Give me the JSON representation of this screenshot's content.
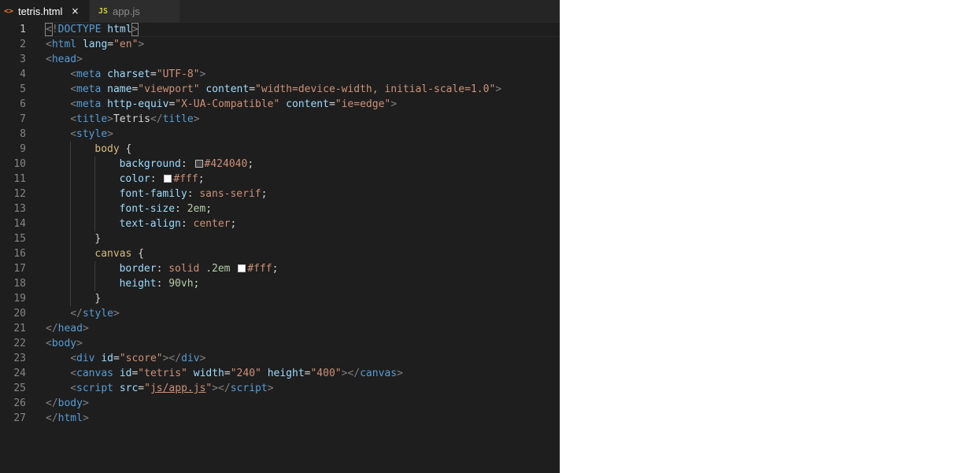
{
  "tabs": [
    {
      "label": "tetris.html",
      "icon": "<>",
      "icon_name": "html-file-icon",
      "active": true,
      "close": "×"
    },
    {
      "label": "app.js",
      "icon": "JS",
      "icon_name": "javascript-file-icon",
      "active": false
    }
  ],
  "colors": {
    "editor_bg": "#1e1e1e",
    "tabbar_bg": "#252526",
    "tag": "#569cd6",
    "attr": "#9cdcfe",
    "string": "#ce9178",
    "punctuation": "#808080",
    "selector": "#d7ba7d",
    "number": "#b5cea8"
  },
  "editor": {
    "current_line": 1,
    "lines": [
      {
        "n": "1",
        "indent": 0,
        "tokens": [
          [
            "punc",
            "<"
          ],
          [
            "punc",
            "!"
          ],
          [
            "tag",
            "DOCTYPE"
          ],
          [
            "text",
            " "
          ],
          [
            "attr",
            "html"
          ],
          [
            "punc",
            ">"
          ]
        ]
      },
      {
        "n": "2",
        "indent": 0,
        "tokens": [
          [
            "punc",
            "<"
          ],
          [
            "tag",
            "html"
          ],
          [
            "text",
            " "
          ],
          [
            "attr",
            "lang"
          ],
          [
            "text",
            "="
          ],
          [
            "str",
            "\"en\""
          ],
          [
            "punc",
            ">"
          ]
        ]
      },
      {
        "n": "3",
        "indent": 0,
        "tokens": [
          [
            "punc",
            "<"
          ],
          [
            "tag",
            "head"
          ],
          [
            "punc",
            ">"
          ]
        ]
      },
      {
        "n": "4",
        "indent": 1,
        "tokens": [
          [
            "punc",
            "<"
          ],
          [
            "tag",
            "meta"
          ],
          [
            "text",
            " "
          ],
          [
            "attr",
            "charset"
          ],
          [
            "text",
            "="
          ],
          [
            "str",
            "\"UTF-8\""
          ],
          [
            "punc",
            ">"
          ]
        ]
      },
      {
        "n": "5",
        "indent": 1,
        "tokens": [
          [
            "punc",
            "<"
          ],
          [
            "tag",
            "meta"
          ],
          [
            "text",
            " "
          ],
          [
            "attr",
            "name"
          ],
          [
            "text",
            "="
          ],
          [
            "str",
            "\"viewport\""
          ],
          [
            "text",
            " "
          ],
          [
            "attr",
            "content"
          ],
          [
            "text",
            "="
          ],
          [
            "str",
            "\"width=device-width, initial-scale=1.0\""
          ],
          [
            "punc",
            ">"
          ]
        ]
      },
      {
        "n": "6",
        "indent": 1,
        "tokens": [
          [
            "punc",
            "<"
          ],
          [
            "tag",
            "meta"
          ],
          [
            "text",
            " "
          ],
          [
            "attr",
            "http-equiv"
          ],
          [
            "text",
            "="
          ],
          [
            "str",
            "\"X-UA-Compatible\""
          ],
          [
            "text",
            " "
          ],
          [
            "attr",
            "content"
          ],
          [
            "text",
            "="
          ],
          [
            "str",
            "\"ie=edge\""
          ],
          [
            "punc",
            ">"
          ]
        ]
      },
      {
        "n": "7",
        "indent": 1,
        "tokens": [
          [
            "punc",
            "<"
          ],
          [
            "tag",
            "title"
          ],
          [
            "punc",
            ">"
          ],
          [
            "text",
            "Tetris"
          ],
          [
            "punc",
            "</"
          ],
          [
            "tag",
            "title"
          ],
          [
            "punc",
            ">"
          ]
        ]
      },
      {
        "n": "8",
        "indent": 1,
        "tokens": [
          [
            "punc",
            "<"
          ],
          [
            "tag",
            "style"
          ],
          [
            "punc",
            ">"
          ]
        ]
      },
      {
        "n": "9",
        "indent": 2,
        "tokens": [
          [
            "sel",
            "body"
          ],
          [
            "text",
            " {"
          ]
        ]
      },
      {
        "n": "10",
        "indent": 3,
        "tokens": [
          [
            "prop",
            "background"
          ],
          [
            "text",
            ": "
          ],
          [
            "swatch",
            "#424040"
          ],
          [
            "val",
            "#424040"
          ],
          [
            "text",
            ";"
          ]
        ]
      },
      {
        "n": "11",
        "indent": 3,
        "tokens": [
          [
            "prop",
            "color"
          ],
          [
            "text",
            ": "
          ],
          [
            "swatch",
            "#fff"
          ],
          [
            "val",
            "#fff"
          ],
          [
            "text",
            ";"
          ]
        ]
      },
      {
        "n": "12",
        "indent": 3,
        "tokens": [
          [
            "prop",
            "font-family"
          ],
          [
            "text",
            ": "
          ],
          [
            "val",
            "sans-serif"
          ],
          [
            "text",
            ";"
          ]
        ]
      },
      {
        "n": "13",
        "indent": 3,
        "tokens": [
          [
            "prop",
            "font-size"
          ],
          [
            "text",
            ": "
          ],
          [
            "num",
            "2em"
          ],
          [
            "text",
            ";"
          ]
        ]
      },
      {
        "n": "14",
        "indent": 3,
        "tokens": [
          [
            "prop",
            "text-align"
          ],
          [
            "text",
            ": "
          ],
          [
            "val",
            "center"
          ],
          [
            "text",
            ";"
          ]
        ]
      },
      {
        "n": "15",
        "indent": 2,
        "tokens": [
          [
            "text",
            "}"
          ]
        ]
      },
      {
        "n": "16",
        "indent": 2,
        "tokens": [
          [
            "sel",
            "canvas"
          ],
          [
            "text",
            " {"
          ]
        ]
      },
      {
        "n": "17",
        "indent": 3,
        "tokens": [
          [
            "prop",
            "border"
          ],
          [
            "text",
            ": "
          ],
          [
            "val",
            "solid"
          ],
          [
            "text",
            " "
          ],
          [
            "num",
            ".2em"
          ],
          [
            "text",
            " "
          ],
          [
            "swatch",
            "#fff"
          ],
          [
            "val",
            "#fff"
          ],
          [
            "text",
            ";"
          ]
        ]
      },
      {
        "n": "18",
        "indent": 3,
        "tokens": [
          [
            "prop",
            "height"
          ],
          [
            "text",
            ": "
          ],
          [
            "num",
            "90vh"
          ],
          [
            "text",
            ";"
          ]
        ]
      },
      {
        "n": "19",
        "indent": 2,
        "tokens": [
          [
            "text",
            "}"
          ]
        ]
      },
      {
        "n": "20",
        "indent": 1,
        "tokens": [
          [
            "punc",
            "</"
          ],
          [
            "tag",
            "style"
          ],
          [
            "punc",
            ">"
          ]
        ]
      },
      {
        "n": "21",
        "indent": 0,
        "tokens": [
          [
            "punc",
            "</"
          ],
          [
            "tag",
            "head"
          ],
          [
            "punc",
            ">"
          ]
        ]
      },
      {
        "n": "22",
        "indent": 0,
        "tokens": [
          [
            "punc",
            "<"
          ],
          [
            "tag",
            "body"
          ],
          [
            "punc",
            ">"
          ]
        ]
      },
      {
        "n": "23",
        "indent": 1,
        "tokens": [
          [
            "punc",
            "<"
          ],
          [
            "tag",
            "div"
          ],
          [
            "text",
            " "
          ],
          [
            "attr",
            "id"
          ],
          [
            "text",
            "="
          ],
          [
            "str",
            "\"score\""
          ],
          [
            "punc",
            "></"
          ],
          [
            "tag",
            "div"
          ],
          [
            "punc",
            ">"
          ]
        ]
      },
      {
        "n": "24",
        "indent": 1,
        "tokens": [
          [
            "punc",
            "<"
          ],
          [
            "tag",
            "canvas"
          ],
          [
            "text",
            " "
          ],
          [
            "attr",
            "id"
          ],
          [
            "text",
            "="
          ],
          [
            "str",
            "\"tetris\""
          ],
          [
            "text",
            " "
          ],
          [
            "attr",
            "width"
          ],
          [
            "text",
            "="
          ],
          [
            "str",
            "\"240\""
          ],
          [
            "text",
            " "
          ],
          [
            "attr",
            "height"
          ],
          [
            "text",
            "="
          ],
          [
            "str",
            "\"400\""
          ],
          [
            "punc",
            "></"
          ],
          [
            "tag",
            "canvas"
          ],
          [
            "punc",
            ">"
          ]
        ]
      },
      {
        "n": "25",
        "indent": 1,
        "tokens": [
          [
            "punc",
            "<"
          ],
          [
            "tag",
            "script"
          ],
          [
            "text",
            " "
          ],
          [
            "attr",
            "src"
          ],
          [
            "text",
            "="
          ],
          [
            "str",
            "\""
          ],
          [
            "link",
            "js/app.js"
          ],
          [
            "str",
            "\""
          ],
          [
            "punc",
            "></"
          ],
          [
            "tag",
            "script"
          ],
          [
            "punc",
            ">"
          ]
        ]
      },
      {
        "n": "26",
        "indent": 0,
        "tokens": [
          [
            "punc",
            "</"
          ],
          [
            "tag",
            "body"
          ],
          [
            "punc",
            ">"
          ]
        ]
      },
      {
        "n": "27",
        "indent": 0,
        "tokens": [
          [
            "punc",
            "</"
          ],
          [
            "tag",
            "html"
          ],
          [
            "punc",
            ">"
          ]
        ]
      }
    ]
  }
}
